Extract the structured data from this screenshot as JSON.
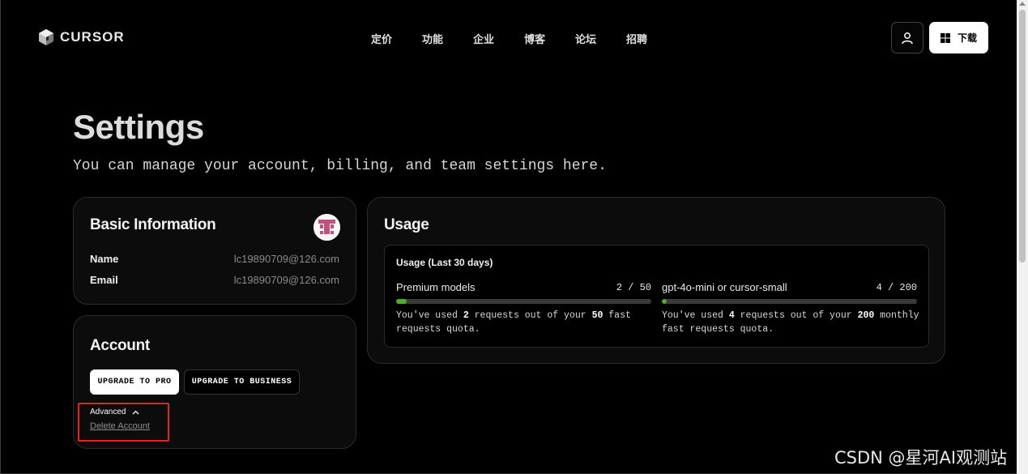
{
  "header": {
    "brand": "CURSOR",
    "nav": [
      "定价",
      "功能",
      "企业",
      "博客",
      "论坛",
      "招聘"
    ],
    "download_label": "下载",
    "icons": {
      "logo": "cursor-cube-logo",
      "user": "user-icon",
      "windows": "windows-icon"
    }
  },
  "hero": {
    "title": "Settings",
    "subtitle": "You can manage your account, billing, and team settings here."
  },
  "basic_info": {
    "title": "Basic Information",
    "name_label": "Name",
    "name_value": "lc19890709@126.com",
    "email_label": "Email",
    "email_value": "lc19890709@126.com"
  },
  "account": {
    "title": "Account",
    "upgrade_pro": "UPGRADE TO PRO",
    "upgrade_business": "UPGRADE TO BUSINESS",
    "advanced_label": "Advanced",
    "delete_label": "Delete Account"
  },
  "usage": {
    "title": "Usage",
    "period_label": "Usage (Last 30 days)",
    "models": [
      {
        "name": "Premium models",
        "count": "2 / 50",
        "used": 2,
        "limit": 50,
        "desc_pre": "You've used ",
        "desc_used": "2",
        "desc_mid": " requests out of your ",
        "desc_limit": "50",
        "desc_post": " fast requests quota."
      },
      {
        "name": "gpt-4o-mini or cursor-small",
        "count": "4 / 200",
        "used": 4,
        "limit": 200,
        "desc_pre": "You've used ",
        "desc_used": "4",
        "desc_mid": " requests out of your ",
        "desc_limit": "200",
        "desc_post": " monthly fast requests quota."
      }
    ]
  },
  "watermark": "CSDN @星河AI观测站",
  "colors": {
    "accent_green": "#4caf2a",
    "highlight_red": "#e0262a",
    "background": "#000000"
  }
}
